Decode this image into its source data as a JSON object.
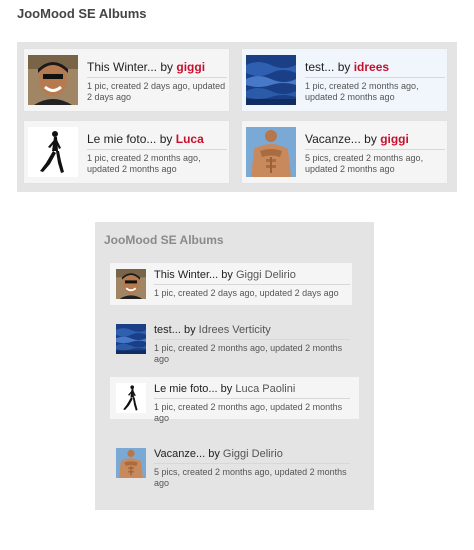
{
  "widget1": {
    "title": "JooMood SE Albums",
    "by": "by",
    "cards": [
      {
        "album": "This Winter...",
        "user": "giggi",
        "meta": "1 pic, created 2 days ago, updated 2 days ago"
      },
      {
        "album": "test...",
        "user": "idrees",
        "meta": "1 pic, created 2 months ago, updated 2 months ago"
      },
      {
        "album": "Le mie foto...",
        "user": "Luca",
        "meta": "1 pic, created 2 months ago, updated 2 months ago"
      },
      {
        "album": "Vacanze...",
        "user": "giggi",
        "meta": "5 pics, created 2 months ago, updated 2 months ago"
      }
    ]
  },
  "widget2": {
    "title": "JooMood SE Albums",
    "by": "by",
    "rows": [
      {
        "album": "This Winter...",
        "user": "Giggi Delirio",
        "meta": "1 pic, created 2 days ago, updated 2 days ago"
      },
      {
        "album": "test...",
        "user": "Idrees Verticity",
        "meta": "1 pic, created 2 months ago, updated 2 months ago"
      },
      {
        "album": "Le mie foto...",
        "user": "Luca Paolini",
        "meta": "1 pic, created 2 months ago, updated 2 months ago"
      },
      {
        "album": "Vacanze...",
        "user": "Giggi Delirio",
        "meta": "5 pics, created 2 months ago, updated 2 months ago"
      }
    ]
  },
  "colors": {
    "user_link": "#c8102e",
    "panel_bg": "#e4e4e4",
    "card_gray": "#f5f5f5",
    "card_blue": "#f0f6fc"
  },
  "thumbnails": [
    "portrait-photo",
    "blue-wave-photo",
    "figure-silhouette-photo",
    "shirtless-man-photo"
  ]
}
